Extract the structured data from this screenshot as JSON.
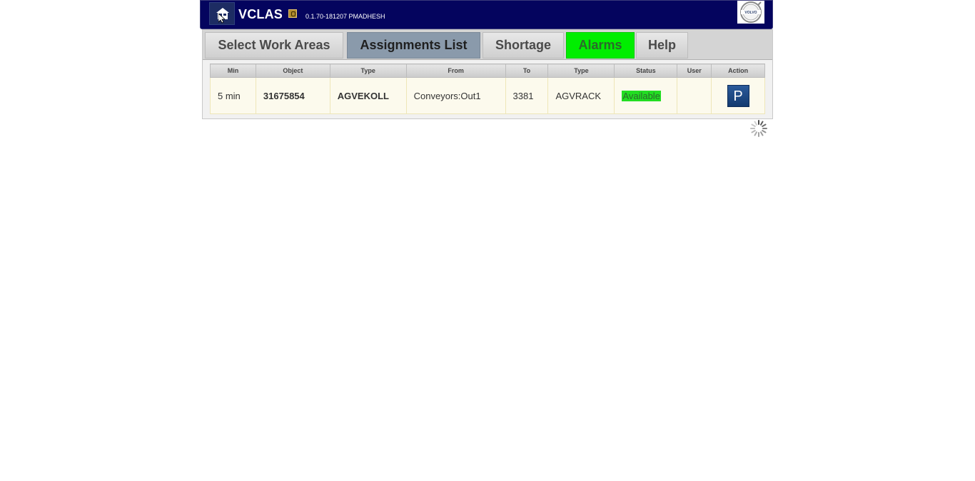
{
  "header": {
    "title": "VCLAS",
    "version": "0.1.70-181207 PMADHESH",
    "home_icon": "home-icon",
    "logo": "VOLVO"
  },
  "tabs": [
    {
      "label": "Select Work Areas",
      "active": false
    },
    {
      "label": "Assignments List",
      "active": true
    },
    {
      "label": "Shortage",
      "active": false
    },
    {
      "label": "Alarms",
      "active": false
    },
    {
      "label": "Help",
      "active": false
    }
  ],
  "table": {
    "headers": [
      "Min",
      "Object",
      "Type",
      "From",
      "To",
      "Type",
      "Status",
      "User",
      "Action"
    ],
    "rows": [
      {
        "min": "5 min",
        "object": "31675854",
        "type": "AGVEKOLL",
        "from": "Conveyors:Out1",
        "to": "3381",
        "to_type": "AGVRACK",
        "status": "Available",
        "user": "",
        "action": "P"
      }
    ]
  },
  "colors": {
    "header_bg": "#04045e",
    "alarm_tab": "#00ee00",
    "active_tab": "#8a9aab",
    "status_available": "#22dd22"
  }
}
